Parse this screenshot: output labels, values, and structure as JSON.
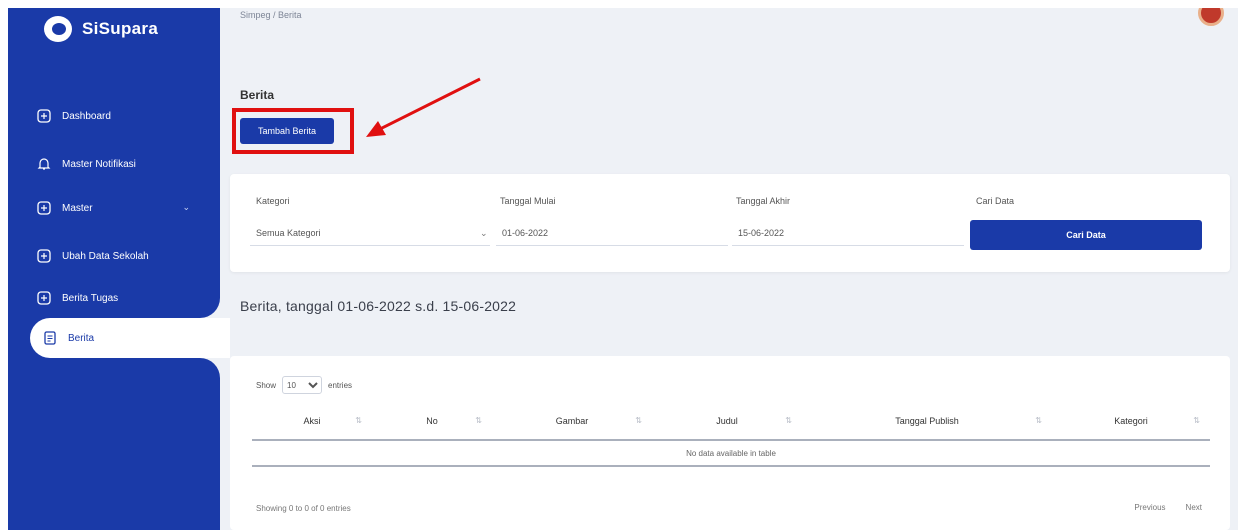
{
  "app": {
    "title": "SiSupara"
  },
  "breadcrumb": "Simpeg / Berita",
  "sidebar": {
    "items": [
      {
        "label": "Dashboard",
        "icon": "grid-icon"
      },
      {
        "label": "Master Notifikasi",
        "icon": "bell-icon"
      },
      {
        "label": "Master",
        "icon": "grid-icon",
        "has_children": true
      },
      {
        "label": "Ubah Data Sekolah",
        "icon": "grid-icon"
      },
      {
        "label": "Berita Tugas",
        "icon": "grid-icon"
      },
      {
        "label": "Berita",
        "icon": "document-icon",
        "active": true
      }
    ]
  },
  "page": {
    "title": "Berita",
    "add_button": "Tambah Berita"
  },
  "filter": {
    "category_label": "Kategori",
    "category_value": "Semua Kategori",
    "start_label": "Tanggal Mulai",
    "start_value": "01-06-2022",
    "end_label": "Tanggal Akhir",
    "end_value": "15-06-2022",
    "search_label": "Cari Data",
    "search_button": "Cari Data"
  },
  "section_title": "Berita, tanggal 01-06-2022 s.d. 15-06-2022",
  "table": {
    "show_label": "Show",
    "page_length": "10",
    "entries_label": "entries",
    "columns": [
      "Aksi",
      "No",
      "Gambar",
      "Judul",
      "Tanggal Publish",
      "Kategori"
    ],
    "empty_message": "No data available in table",
    "info": "Showing 0 to 0 of 0 entries",
    "prev": "Previous",
    "next": "Next"
  },
  "colors": {
    "primary": "#1a3aa8",
    "highlight": "#e01010",
    "background": "#eef1f6"
  }
}
